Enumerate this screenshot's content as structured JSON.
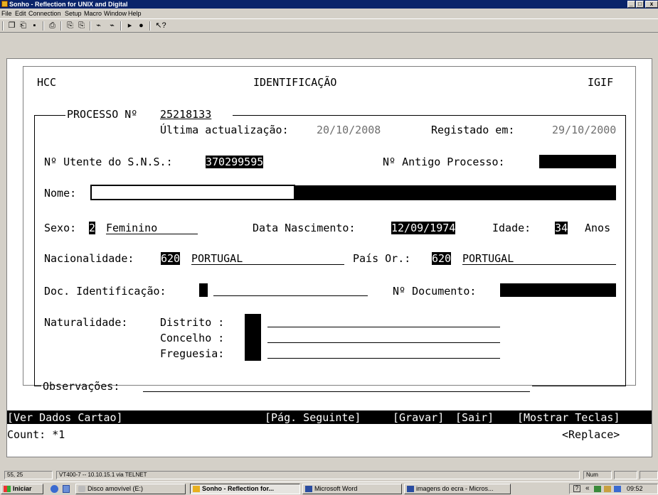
{
  "window": {
    "title": "Sonho - Reflection for UNIX and Digital",
    "minimize": "_",
    "maximize": "□",
    "close": "x"
  },
  "menu": [
    "File",
    "Edit",
    "Connection",
    "Setup",
    "Macro",
    "Window",
    "Help"
  ],
  "toolbar_icons": [
    "new-icon",
    "open-icon",
    "save-icon",
    "print-icon",
    "copy-icon",
    "paste-icon",
    "connect-icon",
    "disconnect-icon",
    "play-icon",
    "record-icon",
    "help-pointer-icon"
  ],
  "toolbar_glyphs": [
    "❐",
    "⎗",
    "▪",
    "⎙",
    "⎘",
    "⎘",
    "⌁",
    "⌁",
    "▸",
    "●",
    "↖?"
  ],
  "screen": {
    "header_left": "HCC",
    "header_center": "IDENTIFICAÇÃO",
    "header_right": "IGIF",
    "processo_label": "PROCESSO Nº",
    "processo_value": "25218133",
    "ultima_label": "Última actualização:",
    "ultima_value": "20/10/2008",
    "registado_label": "Registado em:",
    "registado_value": "29/10/2000",
    "utente_label": "Nº Utente do S.N.S.:",
    "utente_value": "370299595",
    "antigo_label": "Nº Antigo Processo:",
    "nome_label": "Nome:",
    "sexo_label": "Sexo:",
    "sexo_code": "2",
    "sexo_desc": "Feminino",
    "nascimento_label": "Data Nascimento:",
    "nascimento_value": "12/09/1974",
    "idade_label": "Idade:",
    "idade_value": "34",
    "idade_unit": "Anos",
    "nacionalidade_label": "Nacionalidade:",
    "nacionalidade_code": "620",
    "nacionalidade_desc": "PORTUGAL",
    "pais_label": "País Or.:",
    "pais_code": "620",
    "pais_desc": "PORTUGAL",
    "doc_label": "Doc. Identificação:",
    "ndoc_label": "Nº Documento:",
    "naturalidade_label": "Naturalidade:",
    "distrito_label": "Distrito :",
    "concelho_label": "Concelho :",
    "freguesia_label": "Freguesia:",
    "observacoes_label": "Observações:"
  },
  "function_bar": {
    "ver_dados": "[Ver Dados Cartao]",
    "pag_seguinte": "[Pág. Seguinte]",
    "gravar": "[Gravar]",
    "sair": "[Sair]",
    "mostrar": "[Mostrar Teclas]"
  },
  "count_text": "Count: *1",
  "replace_text": "<Replace>",
  "status": {
    "cursor": "55, 25",
    "connection": "VT400-7 -- 10.10.15.1 via TELNET",
    "num": "Num"
  },
  "taskbar": {
    "start": "Iniciar",
    "items": [
      {
        "label": "Disco amovível (E:)",
        "active": false
      },
      {
        "label": "Sonho - Reflection for...",
        "active": true
      },
      {
        "label": "Microsoft Word",
        "active": false
      },
      {
        "label": "imagens do ecra - Micros...",
        "active": false
      }
    ],
    "tray_chevron": "«",
    "clock": "09:52"
  }
}
